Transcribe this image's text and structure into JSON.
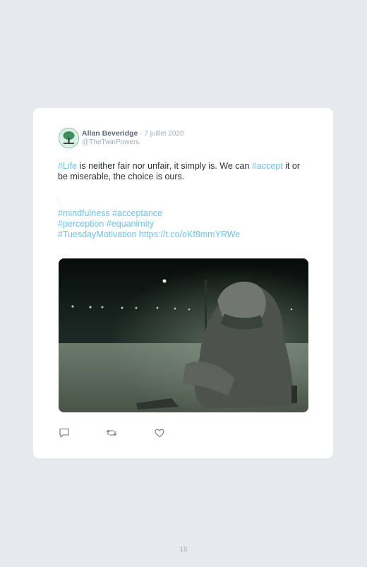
{
  "tweet": {
    "author_name": "Allan Beveridge",
    "date": "· 7 juillet 2020",
    "handle": "@TheTwinPowers",
    "line1_tag": "#Life",
    "line1_text_a": " is neither fair nor unfair, it simply is. We can ",
    "line1_tag2": "#accept",
    "line1_text_b": " it or be miserable, the choice is ours.",
    "separator": ".",
    "hashtags": [
      "#mindfulness",
      "#acceptance",
      "#perception",
      "#equanimity",
      "#TuesdayMotivation"
    ],
    "url": "https://t.co/oKf8mmYRWe",
    "image_alt": "Hooded person sitting alone on a road at night"
  },
  "actions": [
    {
      "name": "reply",
      "icon": "reply-icon"
    },
    {
      "name": "retweet",
      "icon": "retweet-icon"
    },
    {
      "name": "like",
      "icon": "heart-icon"
    }
  ],
  "colors": {
    "link": "#6fc1e6",
    "text": "#2b2f33",
    "muted": "#a5aeb8",
    "background": "#e6e9ed"
  },
  "page_number": "16"
}
